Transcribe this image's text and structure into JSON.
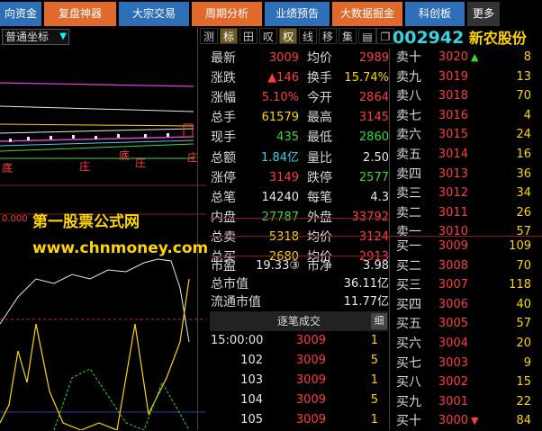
{
  "tabs": [
    "向资金",
    "复盘神器",
    "大宗交易",
    "周期分析",
    "业绩预告",
    "大数据掘金",
    "科创板",
    "更多"
  ],
  "toolbar": {
    "coord": "普通坐标",
    "buttons": [
      "测",
      "标",
      "田",
      "叹",
      "权",
      "线",
      "移",
      "集"
    ]
  },
  "stock": {
    "code": "002942",
    "name": "新农股份"
  },
  "quote_left": [
    {
      "label": "最新",
      "value": "3009",
      "color": "red"
    },
    {
      "label": "涨跌",
      "value": "▲146",
      "color": "red"
    },
    {
      "label": "涨幅",
      "value": "5.10%",
      "color": "red"
    },
    {
      "label": "总手",
      "value": "61579",
      "color": "yellow"
    },
    {
      "label": "现手",
      "value": "435",
      "color": "green"
    },
    {
      "label": "总额",
      "value": "1.84亿",
      "color": "cyan"
    },
    {
      "label": "涨停",
      "value": "3149",
      "color": "red"
    },
    {
      "label": "总笔",
      "value": "14240",
      "color": "white"
    },
    {
      "label": "内盘",
      "value": "27787",
      "color": "green"
    },
    {
      "label": "总卖",
      "value": "5318",
      "color": "yellow"
    },
    {
      "label": "总买",
      "value": "2680",
      "color": "yellow"
    }
  ],
  "quote_right": [
    {
      "label": "均价",
      "value": "2989",
      "color": "red"
    },
    {
      "label": "换手",
      "value": "15.74%",
      "color": "yellow"
    },
    {
      "label": "今开",
      "value": "2864",
      "color": "red"
    },
    {
      "label": "最高",
      "value": "3145",
      "color": "red"
    },
    {
      "label": "最低",
      "value": "2860",
      "color": "green"
    },
    {
      "label": "量比",
      "value": "2.50",
      "color": "white"
    },
    {
      "label": "跌停",
      "value": "2577",
      "color": "green"
    },
    {
      "label": "每笔",
      "value": "4.3",
      "color": "white"
    },
    {
      "label": "外盘",
      "value": "33792",
      "color": "red"
    },
    {
      "label": "均价",
      "value": "3124",
      "color": "red"
    },
    {
      "label": "均价",
      "value": "2913",
      "color": "red"
    }
  ],
  "valuation": [
    {
      "label": "市盈",
      "value": "19.33③",
      "label2": "市净",
      "value2": "3.98"
    },
    {
      "label": "总市值",
      "value": "36.11亿"
    },
    {
      "label": "流通市值",
      "value": "11.77亿"
    }
  ],
  "asks": [
    {
      "label": "卖十",
      "price": "3020",
      "vol": "8",
      "mark": "▲"
    },
    {
      "label": "卖九",
      "price": "3019",
      "vol": "13"
    },
    {
      "label": "卖八",
      "price": "3018",
      "vol": "70"
    },
    {
      "label": "卖七",
      "price": "3016",
      "vol": "4"
    },
    {
      "label": "卖六",
      "price": "3015",
      "vol": "24"
    },
    {
      "label": "卖五",
      "price": "3014",
      "vol": "16"
    },
    {
      "label": "卖四",
      "price": "3013",
      "vol": "36"
    },
    {
      "label": "卖三",
      "price": "3012",
      "vol": "34"
    },
    {
      "label": "卖二",
      "price": "3011",
      "vol": "26"
    },
    {
      "label": "卖一",
      "price": "3010",
      "vol": "57"
    }
  ],
  "bids": [
    {
      "label": "买一",
      "price": "3009",
      "vol": "109"
    },
    {
      "label": "买二",
      "price": "3008",
      "vol": "70"
    },
    {
      "label": "买三",
      "price": "3007",
      "vol": "118"
    },
    {
      "label": "买四",
      "price": "3006",
      "vol": "40"
    },
    {
      "label": "买五",
      "price": "3005",
      "vol": "57"
    },
    {
      "label": "买六",
      "price": "3004",
      "vol": "20"
    },
    {
      "label": "买七",
      "price": "3003",
      "vol": "9"
    },
    {
      "label": "买八",
      "price": "3002",
      "vol": "15"
    },
    {
      "label": "买九",
      "price": "3001",
      "vol": "22"
    },
    {
      "label": "买十",
      "price": "3000",
      "vol": "84",
      "mark": "▼"
    }
  ],
  "trades_header": {
    "title": "逐笔成交",
    "detail": "细"
  },
  "trades": [
    {
      "time": "15:00:00",
      "price": "3009",
      "vol": "1"
    },
    {
      "time": "102",
      "price": "3009",
      "vol": "5"
    },
    {
      "time": "103",
      "price": "3009",
      "vol": "1"
    },
    {
      "time": "104",
      "price": "3009",
      "vol": "5"
    },
    {
      "time": "105",
      "price": "3009",
      "vol": "1"
    }
  ],
  "chart_labels": [
    "底",
    "庄",
    "底",
    "庄",
    "庄"
  ],
  "axis_value": "0.000",
  "watermark": {
    "line1": "第一股票公式网",
    "line2": "www.chnmoney.com"
  }
}
